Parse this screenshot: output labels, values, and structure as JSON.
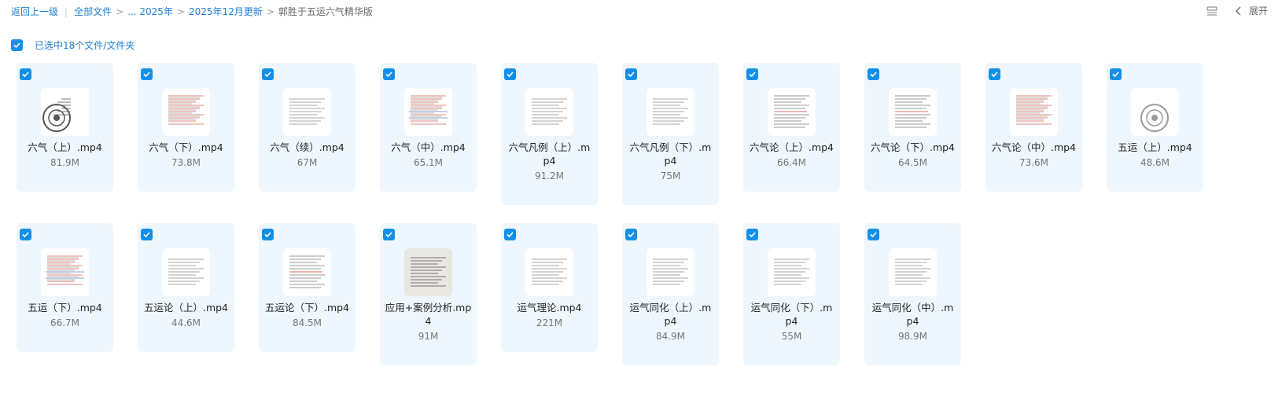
{
  "breadcrumb": {
    "back": "返回上一级",
    "all_files": "全部文件",
    "ellipsis_year": "... 2025年",
    "month": "2025年12月更新",
    "current": "郭胜于五运六气精华版",
    "sep": ">"
  },
  "toolbar": {
    "expand_label": "展开"
  },
  "selection": {
    "label": "已选中18个文件/文件夹"
  },
  "colors": {
    "accent": "#1590e8",
    "card_bg": "#eef7fe",
    "link": "#1f7ed4"
  },
  "files": [
    {
      "line1": "六气（上）.mp4",
      "line2": "",
      "size": "81.9M",
      "thumb": "wheel"
    },
    {
      "line1": "六气（下）.mp4",
      "line2": "",
      "size": "73.8M",
      "thumb": "handwritten"
    },
    {
      "line1": "六气（续）.mp4",
      "line2": "",
      "size": "67M",
      "thumb": "text"
    },
    {
      "line1": "六气（中）.mp4",
      "line2": "",
      "size": "65.1M",
      "thumb": "handwritten-grid"
    },
    {
      "line1": "六气凡例（上）.m",
      "line2": "p4",
      "size": "91.2M",
      "thumb": "text"
    },
    {
      "line1": "六气凡例（下）.m",
      "line2": "p4",
      "size": "75M",
      "thumb": "text"
    },
    {
      "line1": "六气论（上）.mp4",
      "line2": "",
      "size": "66.4M",
      "thumb": "text-red"
    },
    {
      "line1": "六气论（下）.mp4",
      "line2": "",
      "size": "64.5M",
      "thumb": "text-red"
    },
    {
      "line1": "六气论（中）.mp4",
      "line2": "",
      "size": "73.6M",
      "thumb": "handwritten"
    },
    {
      "line1": "五运（上）.mp4",
      "line2": "",
      "size": "48.6M",
      "thumb": "wheel-light"
    },
    {
      "line1": "五运（下）.mp4",
      "line2": "",
      "size": "66.7M",
      "thumb": "handwritten-grid"
    },
    {
      "line1": "五运论（上）.mp4",
      "line2": "",
      "size": "44.6M",
      "thumb": "text"
    },
    {
      "line1": "五运论（下）.mp4",
      "line2": "",
      "size": "84.5M",
      "thumb": "text-red"
    },
    {
      "line1": "应用+案例分析.mp",
      "line2": "4",
      "size": "91M",
      "thumb": "photo"
    },
    {
      "line1": "运气理论.mp4",
      "line2": "",
      "size": "221M",
      "thumb": "text"
    },
    {
      "line1": "运气同化（上）.m",
      "line2": "p4",
      "size": "84.9M",
      "thumb": "text"
    },
    {
      "line1": "运气同化（下）.m",
      "line2": "p4",
      "size": "55M",
      "thumb": "text"
    },
    {
      "line1": "运气同化（中）.m",
      "line2": "p4",
      "size": "98.9M",
      "thumb": "text"
    }
  ]
}
